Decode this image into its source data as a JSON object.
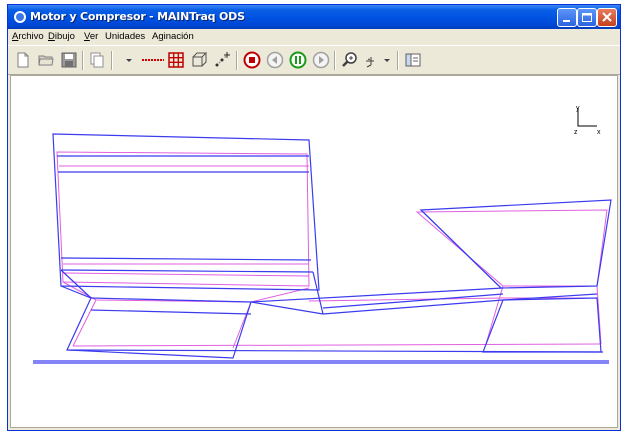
{
  "window": {
    "title": "Motor y Compresor - MAINTraq ODS"
  },
  "menu": [
    {
      "before": "",
      "u": "A",
      "after": "rchivo"
    },
    {
      "before": "",
      "u": "D",
      "after": "ibujo"
    },
    {
      "before": "",
      "u": "V",
      "after": "er"
    },
    {
      "before": "",
      "u": "",
      "after": "Unidades"
    },
    {
      "before": "A",
      "u": "g",
      "after": "inación"
    }
  ],
  "toolbar_icons": [
    "new-file-icon",
    "open-folder-icon",
    "save-icon",
    "copy-icon",
    "dropdown-arrow-icon",
    "dashed-line-icon",
    "grid-icon",
    "cube-wireframe-icon",
    "points-icon",
    "record-icon",
    "step-back-icon",
    "pause-icon",
    "step-forward-icon",
    "zoom-icon",
    "axis-dropdown-icon",
    "panel-icon"
  ],
  "axes_triad": {
    "y": "y",
    "z": "z",
    "x": "x"
  },
  "colors": {
    "title_bar": "#0054e3",
    "wire_blue": "#3b3bf0",
    "wire_magenta": "#e060e0",
    "record_red": "#c00000",
    "pause_green": "#1a9a1a"
  }
}
